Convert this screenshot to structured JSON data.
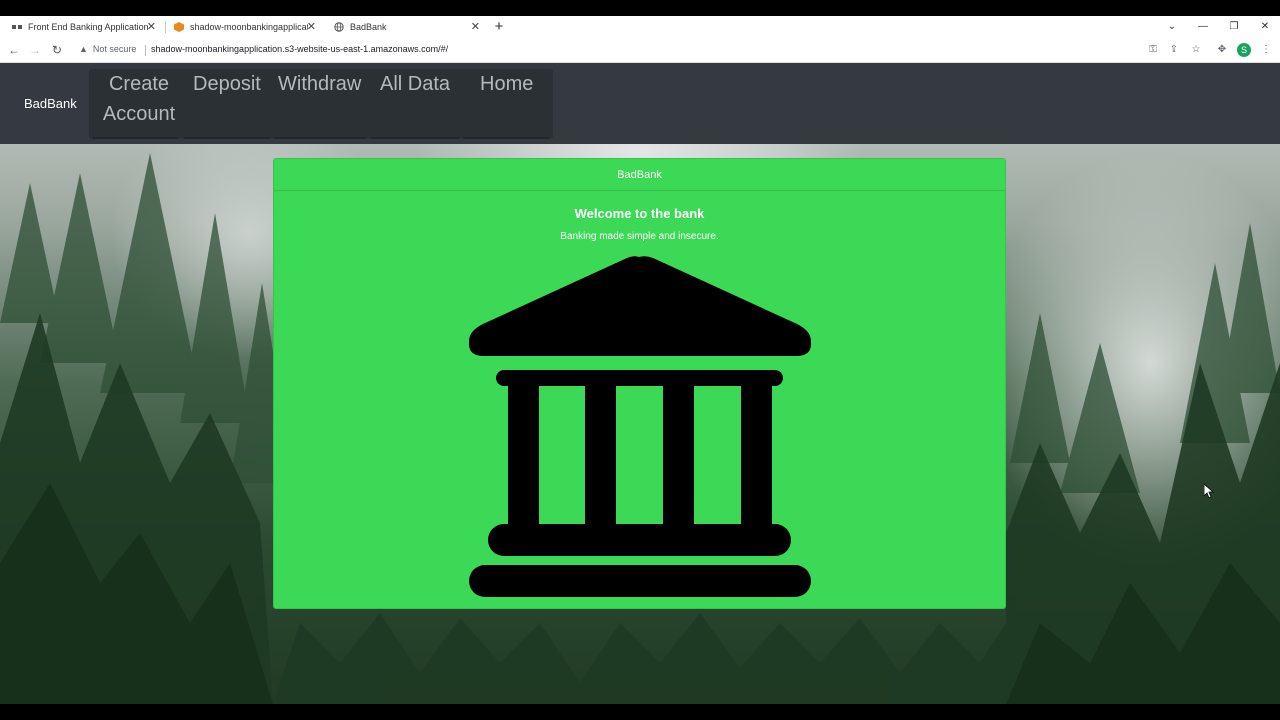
{
  "browser": {
    "tabs": [
      {
        "title": "Front End Banking Application V",
        "favicon": "media-icon"
      },
      {
        "title": "shadow-moonbankingapplicatic",
        "favicon": "aws-s3-icon"
      },
      {
        "title": "BadBank",
        "favicon": "globe-icon"
      }
    ],
    "security_label": "Not secure",
    "url": "shadow-moonbankingapplication.s3-website-us-east-1.amazonaws.com/#/",
    "profile_initial": "S"
  },
  "navbar": {
    "brand": "BadBank",
    "links": {
      "create_line1": "Create",
      "create_line2": "Account",
      "deposit": "Deposit",
      "withdraw": "Withdraw",
      "all_data": "All Data",
      "home": "Home"
    }
  },
  "card": {
    "header": "BadBank",
    "title": "Welcome to the bank",
    "text": "Banking made simple and insecure.",
    "icon": "bank-icon",
    "color": "#3bd955"
  },
  "colors": {
    "navbar_bg": "#343a40",
    "nav_link": "#b5b9bd",
    "card_bg": "#3bd955"
  }
}
